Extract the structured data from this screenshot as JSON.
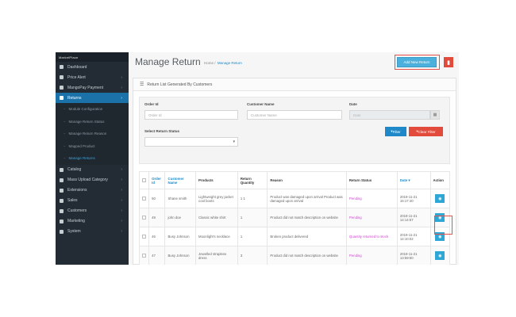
{
  "brand": "MarketPlace",
  "sidebar": {
    "items": [
      {
        "label": "Dashboard",
        "icon": "dashboard-icon",
        "chevron": false
      },
      {
        "label": "Price Alert",
        "icon": "bell-icon",
        "chevron": true
      },
      {
        "label": "MangoPay Payment",
        "icon": "card-icon",
        "chevron": true
      },
      {
        "label": "Returns",
        "icon": "return-icon",
        "chevron": true,
        "active": true
      }
    ],
    "subitems": [
      {
        "label": "Module Configuration"
      },
      {
        "label": "Manage Return Status"
      },
      {
        "label": "Manage Return Reason"
      },
      {
        "label": "Mapped Product"
      },
      {
        "label": "Manage Returns",
        "selected": true
      }
    ],
    "items_after": [
      {
        "label": "Catalog",
        "icon": "tag-icon",
        "chevron": true
      },
      {
        "label": "Mass Upload Category",
        "icon": "user-icon",
        "chevron": true
      },
      {
        "label": "Extensions",
        "icon": "puzzle-icon",
        "chevron": true
      },
      {
        "label": "Sales",
        "icon": "cart-icon",
        "chevron": true
      },
      {
        "label": "Customers",
        "icon": "customers-icon",
        "chevron": true
      },
      {
        "label": "Marketing",
        "icon": "share-icon",
        "chevron": true
      },
      {
        "label": "System",
        "icon": "gear-icon",
        "chevron": true
      }
    ]
  },
  "header": {
    "title": "Manage Return",
    "breadcrumb_home": "Home",
    "breadcrumb_sep": "/",
    "breadcrumb_current": "Manage Return",
    "add_button": "Add New Return",
    "delete_icon": "trash-icon"
  },
  "panel": {
    "heading": "Return List Generated By Customers"
  },
  "filters": {
    "order_id_label": "Order Id",
    "order_id_placeholder": "Order Id",
    "customer_label": "Customer Name",
    "customer_placeholder": "Customer Name",
    "date_label": "Date",
    "date_placeholder": "Date",
    "status_label": "Select Return Status",
    "status_value": "",
    "filter_button": "Filter",
    "clear_button": "Clear Filter"
  },
  "table": {
    "headers": [
      "Order Id",
      "Customer Name",
      "Products",
      "Return Quantity",
      "Reason",
      "Return Status",
      "Date",
      "Action"
    ],
    "rows": [
      {
        "order_id": "50",
        "customer": "Shane smith",
        "products": "Lightweight grey jacket cool boots",
        "qty": "1 1",
        "reason": "Product was damaged upon arrival Product was damaged upon arrival",
        "status": "Pending",
        "date": "2019-11-21 16:17:40"
      },
      {
        "order_id": "49",
        "customer": "john doe",
        "products": "Classic white shirt",
        "qty": "1",
        "reason": "Product did not match description on website",
        "status": "Pending",
        "date": "2019-11-21 14:14:57"
      },
      {
        "order_id": "46",
        "customer": "Busy Johnson",
        "products": "Moonlight's necklace",
        "qty": "1",
        "reason": "Broken product delivered",
        "status": "Quantity returned to stock",
        "date": "2019-11-21 14:10:02"
      },
      {
        "order_id": "47",
        "customer": "Busy Johnson",
        "products": "Jewelled strapless dress",
        "qty": "3",
        "reason": "Product did not match description on website",
        "status": "Pending",
        "date": "2019-11-21 13:59:50"
      }
    ]
  },
  "colors": {
    "sidebar": "#232c35",
    "accent": "#1e88c8",
    "danger": "#e24a3b",
    "status": "#d63dd6",
    "highlight": "#e8514a"
  }
}
